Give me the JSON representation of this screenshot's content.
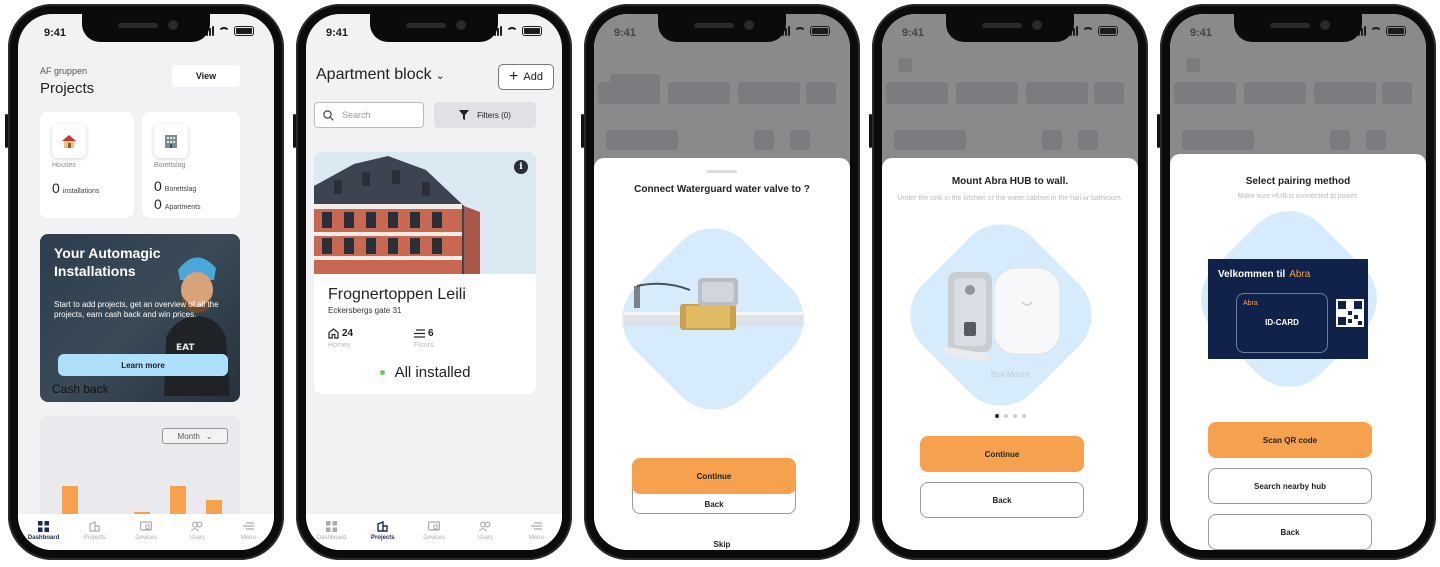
{
  "status_time": "9:41",
  "tabs": [
    "Dashboard",
    "Projects",
    "Devices",
    "Users",
    "Menu"
  ],
  "screen1": {
    "company": "AF gruppen",
    "title": "Projects",
    "view_label": "View",
    "houses_label": "Houses",
    "houses_count": "0",
    "houses_unit": "installations",
    "borettslag_label": "Borettslag",
    "borettslag_count": "0",
    "borettslag_unit": "Borettslag",
    "apartments_count": "0",
    "apartments_unit": "Apartments",
    "promo_title": "Your Automagic Installations",
    "promo_text": "Start to add projects, get an overview of all the projects, earn cash back and win prices.",
    "learn_more": "Learn more",
    "cash_back": "Cash back",
    "period": "Month",
    "bar_values": [
      0.62,
      0.05,
      0.3,
      0.62,
      0.45
    ]
  },
  "screen2": {
    "heading": "Apartment block",
    "add_label": "Add",
    "search_placeholder": "Search",
    "filters_label": "Filters (0)",
    "project_name": "Frognertoppen Leili",
    "project_address": "Eckersbergs gate 31",
    "homes_count": "24",
    "homes_label": "Homes",
    "floors_count": "6",
    "floors_label": "Floors",
    "installed_status": "All installed"
  },
  "screen3": {
    "title": "Connect Waterguard water valve to ?",
    "continue_label": "Continue",
    "back_label": "Back",
    "skip_label": "Skip"
  },
  "screen4": {
    "title": "Mount Abra HUB to wall.",
    "subtitle": "Under the sink in the kitchen or the water cabinet in the hall or bathroom.",
    "image_caption": "Box Mount",
    "continue_label": "Continue",
    "back_label": "Back"
  },
  "screen5": {
    "title": "Select pairing method",
    "subtitle": "Make sure HUB is connected to power.",
    "card_welcome": "Velkommen til",
    "card_brand": "Abra",
    "card_inner_brand": "Abra",
    "card_id": "ID-CARD",
    "scan_label": "Scan QR code",
    "nearby_label": "Search nearby hub",
    "back_label": "Back"
  },
  "colors": {
    "accent_orange": "#f6a14d",
    "light_blue": "#d6ebfb",
    "navy": "#1c2a4a",
    "installed_green": "#5ccc6b"
  }
}
